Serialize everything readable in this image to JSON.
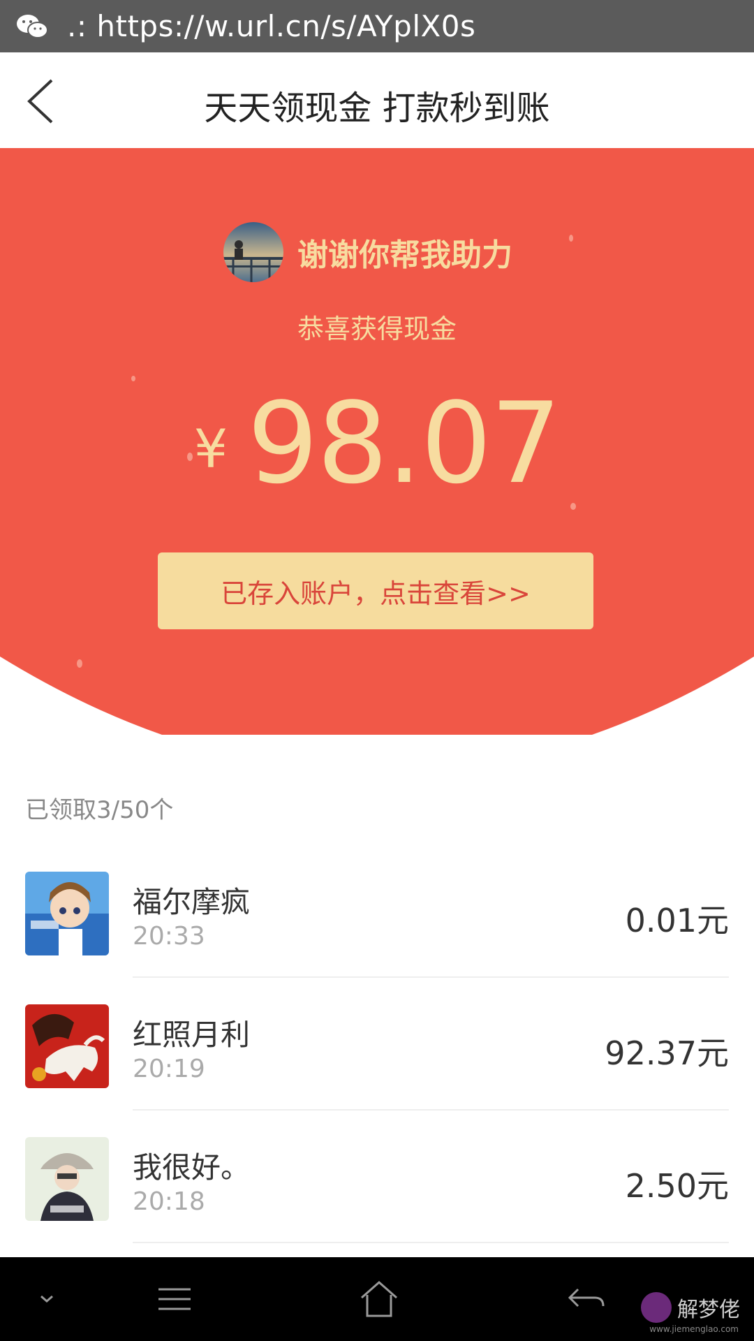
{
  "url_bar": {
    "icon": "wechat-icon",
    "url": ".: https://w.url.cn/s/AYplX0s"
  },
  "header": {
    "back_icon": "chevron-left-icon",
    "title": "天天领现金 打款秒到账"
  },
  "hero": {
    "giver_text": "谢谢你帮我助力",
    "subtitle": "恭喜获得现金",
    "currency": "¥",
    "amount": "98.07",
    "button_label": "已存入账户，点击查看>>",
    "colors": {
      "background": "#f15848",
      "text": "#f7dca0",
      "button_bg": "#f6dc9e",
      "button_text": "#d9453a"
    }
  },
  "list": {
    "count_text": "已领取3/50个",
    "items": [
      {
        "name": "福尔摩疯",
        "time": "20:33",
        "amount": "0.01元"
      },
      {
        "name": "红照月利",
        "time": "20:19",
        "amount": "92.37元"
      },
      {
        "name": "我很好。",
        "time": "20:18",
        "amount": "2.50元"
      }
    ]
  },
  "navbar": {
    "icons": [
      "chevron-down-icon",
      "menu-icon",
      "home-icon",
      "back-arrow-icon"
    ]
  },
  "watermark": {
    "text": "解梦佬",
    "sub": "www.jiemenglao.com"
  }
}
